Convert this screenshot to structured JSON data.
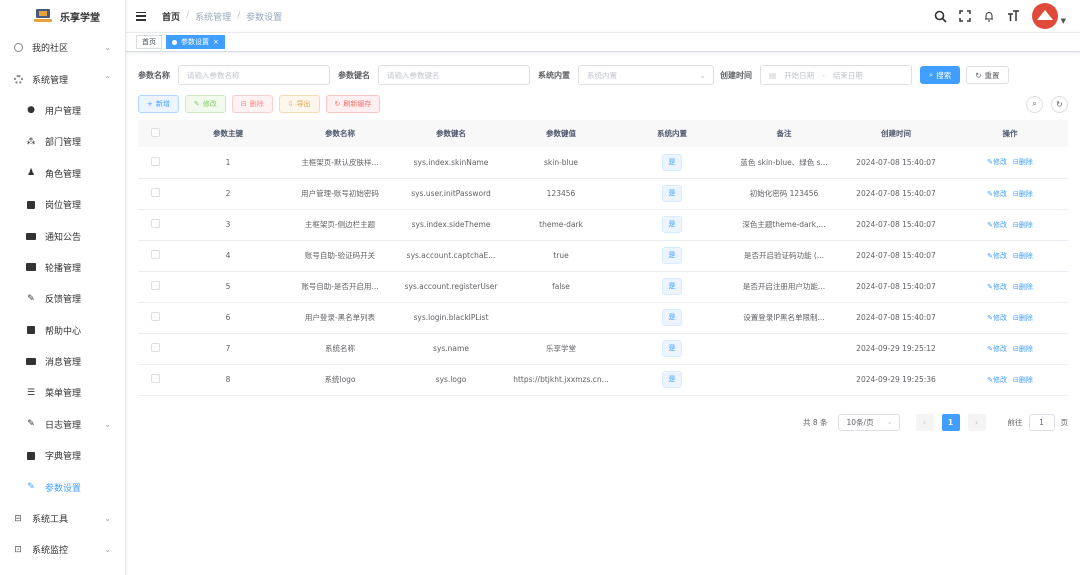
{
  "app": {
    "title": "乐享学堂"
  },
  "sidebar": {
    "items": [
      {
        "label": "我的社区",
        "icon": "community-icon",
        "arrow": "⌄"
      },
      {
        "label": "系统管理",
        "icon": "gear-icon",
        "arrow": "⌃"
      },
      {
        "label": "用户管理",
        "icon": "user-icon"
      },
      {
        "label": "部门管理",
        "icon": "tree-icon"
      },
      {
        "label": "角色管理",
        "icon": "peoples-icon"
      },
      {
        "label": "岗位管理",
        "icon": "post-icon"
      },
      {
        "label": "通知公告",
        "icon": "message-icon"
      },
      {
        "label": "轮播管理",
        "icon": "image-icon"
      },
      {
        "label": "反馈管理",
        "icon": "edit-icon"
      },
      {
        "label": "帮助中心",
        "icon": "help-icon"
      },
      {
        "label": "消息管理",
        "icon": "chat-icon"
      },
      {
        "label": "菜单管理",
        "icon": "tree-table-icon"
      },
      {
        "label": "日志管理",
        "icon": "log-icon",
        "arrow": "⌄"
      },
      {
        "label": "字典管理",
        "icon": "dict-icon"
      },
      {
        "label": "参数设置",
        "icon": "edit-icon"
      },
      {
        "label": "系统工具",
        "icon": "tool-icon",
        "arrow": "⌄"
      },
      {
        "label": "系统监控",
        "icon": "monitor-icon",
        "arrow": "⌄"
      }
    ]
  },
  "breadcrumb": {
    "home": "首页",
    "level1": "系统管理",
    "level2": "参数设置",
    "sep": "/"
  },
  "tags": {
    "home": "首页",
    "current": "参数设置",
    "close": "×"
  },
  "filters": {
    "name_label": "参数名称",
    "name_placeholder": "请输入参数名称",
    "key_label": "参数键名",
    "key_placeholder": "请输入参数键名",
    "type_label": "系统内置",
    "type_placeholder": "系统内置",
    "time_label": "创建时间",
    "start_placeholder": "开始日期",
    "range_sep": "-",
    "end_placeholder": "结束日期",
    "search_btn": "搜索",
    "reset_btn": "重置"
  },
  "toolbar": {
    "add": "新增",
    "edit": "修改",
    "delete": "删除",
    "export": "导出",
    "refresh_cache": "刷新缓存"
  },
  "table": {
    "headers": [
      "参数主键",
      "参数名称",
      "参数键名",
      "参数键值",
      "系统内置",
      "备注",
      "创建时间",
      "操作"
    ],
    "op_edit": "修改",
    "op_delete": "删除",
    "rows": [
      {
        "id": "1",
        "name": "主框架页-默认皮肤样...",
        "key": "sys.index.skinName",
        "value": "skin-blue",
        "builtin": "是",
        "remark": "蓝色 skin-blue、绿色 s...",
        "time": "2024-07-08 15:40:07"
      },
      {
        "id": "2",
        "name": "用户管理-账号初始密码",
        "key": "sys.user.initPassword",
        "value": "123456",
        "builtin": "是",
        "remark": "初始化密码 123456",
        "time": "2024-07-08 15:40:07"
      },
      {
        "id": "3",
        "name": "主框架页-侧边栏主题",
        "key": "sys.index.sideTheme",
        "value": "theme-dark",
        "builtin": "是",
        "remark": "深色主题theme-dark,...",
        "time": "2024-07-08 15:40:07"
      },
      {
        "id": "4",
        "name": "账号自助-验证码开关",
        "key": "sys.account.captchaE...",
        "value": "true",
        "builtin": "是",
        "remark": "是否开启验证码功能 (...",
        "time": "2024-07-08 15:40:07"
      },
      {
        "id": "5",
        "name": "账号自助-是否开启用...",
        "key": "sys.account.registerUser",
        "value": "false",
        "builtin": "是",
        "remark": "是否开启注册用户功能...",
        "time": "2024-07-08 15:40:07"
      },
      {
        "id": "6",
        "name": "用户登录-黑名单列表",
        "key": "sys.login.blackIPList",
        "value": "",
        "builtin": "是",
        "remark": "设置登录IP黑名单限制...",
        "time": "2024-07-08 15:40:07"
      },
      {
        "id": "7",
        "name": "系统名称",
        "key": "sys.name",
        "value": "乐享学堂",
        "builtin": "是",
        "remark": "",
        "time": "2024-09-29 19:25:12"
      },
      {
        "id": "8",
        "name": "系统logo",
        "key": "sys.logo",
        "value": "https://btjkht.jxxmzs.cn...",
        "builtin": "是",
        "remark": "",
        "time": "2024-09-29 19:25:36"
      }
    ]
  },
  "pagination": {
    "total": "共 8 条",
    "page_size": "10条/页",
    "current_page": "1",
    "goto_label": "前往",
    "goto_value": "1",
    "page_unit": "页"
  },
  "colors": {
    "primary": "#409eff",
    "avatar": "#e04a3b"
  }
}
